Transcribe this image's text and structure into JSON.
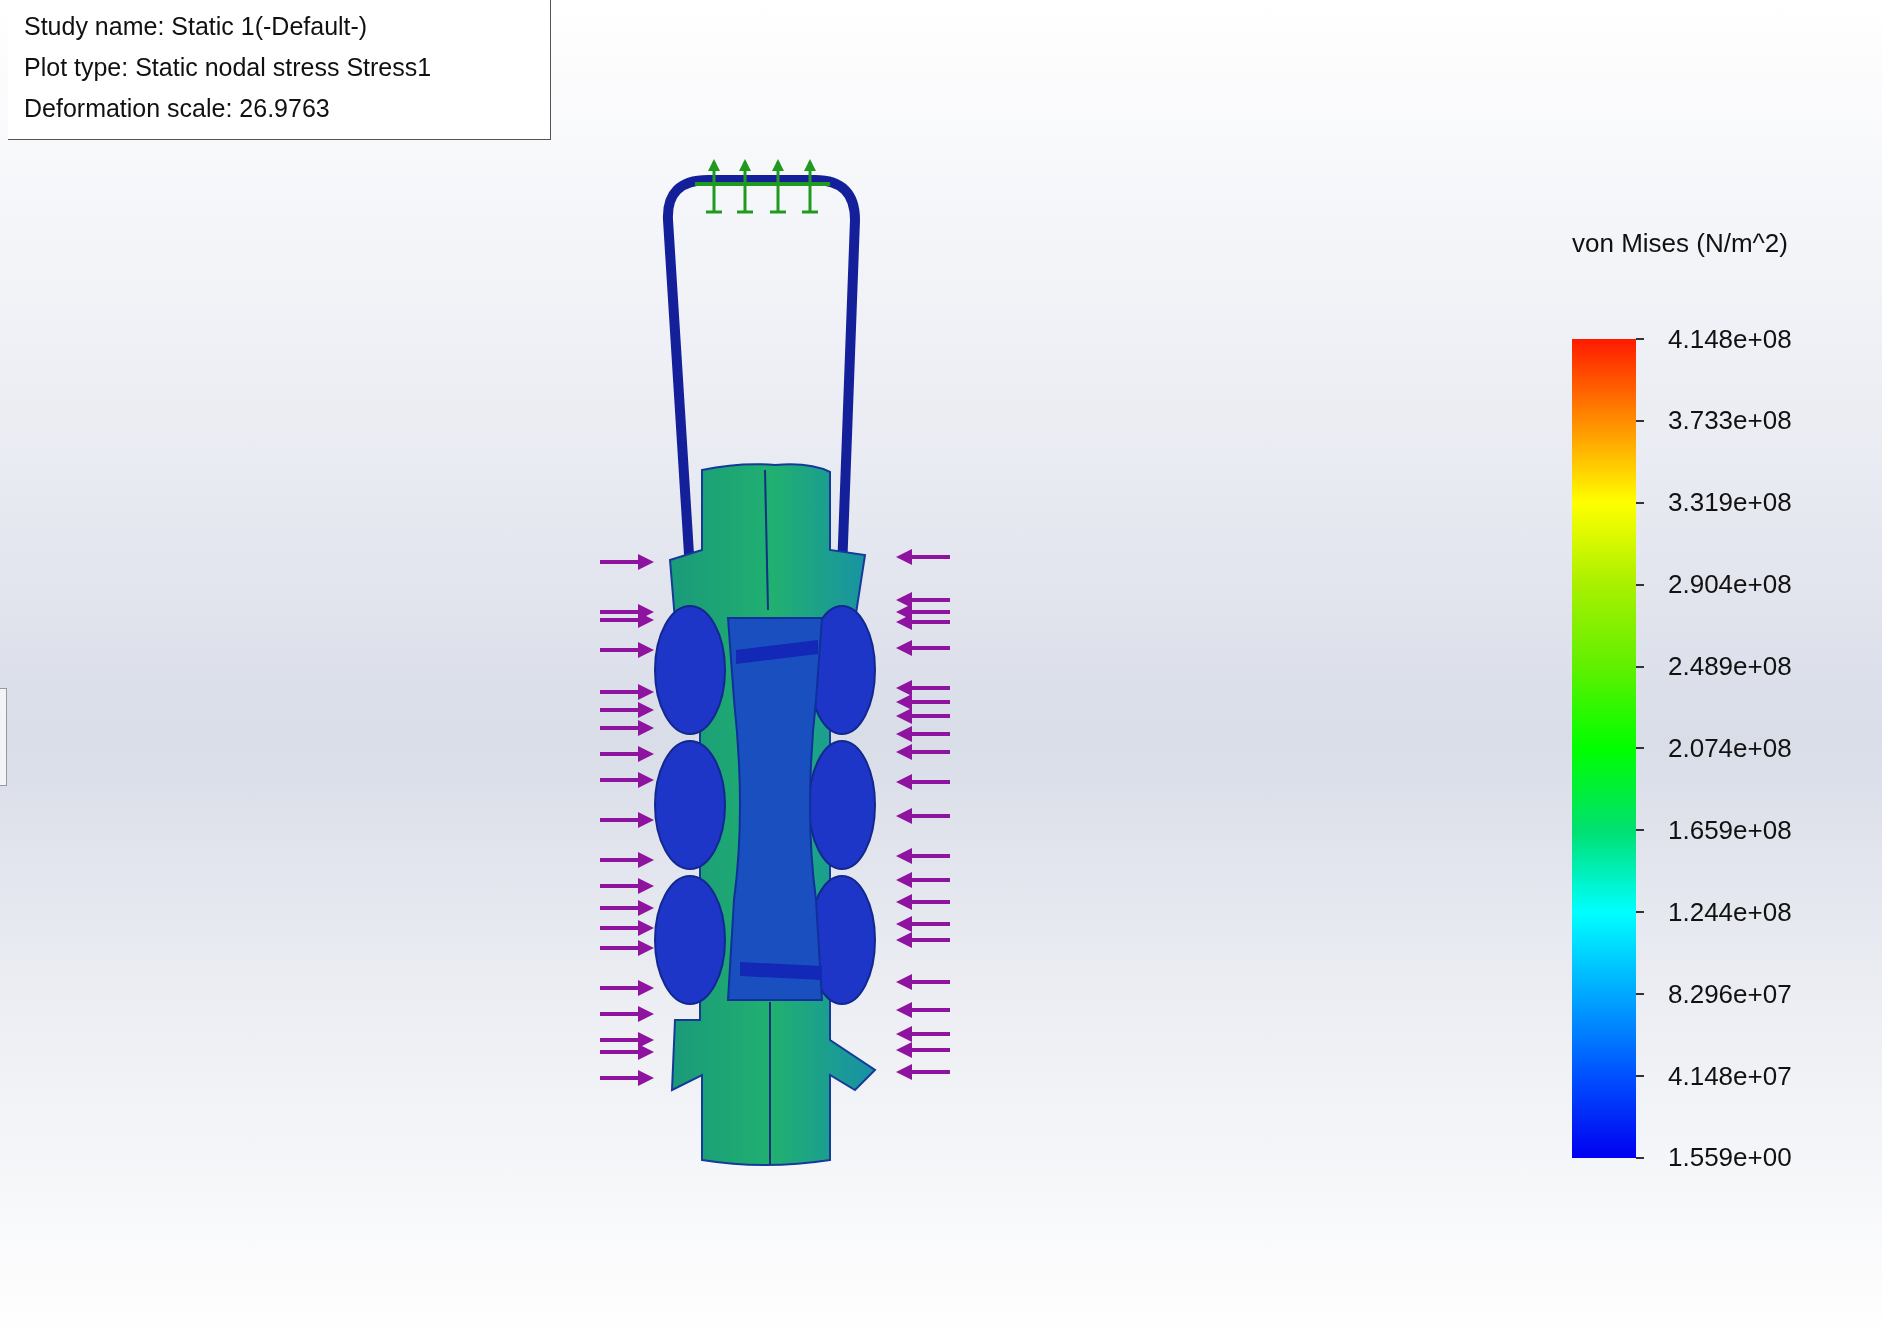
{
  "plot_info": {
    "lines": [
      "Study name: Static 1(-Default-)",
      "Plot type: Static nodal stress Stress1",
      "Deformation scale: 26.9763"
    ]
  },
  "legend": {
    "title": "von Mises (N/m^2)",
    "labels": [
      "4.148e+08",
      "3.733e+08",
      "3.319e+08",
      "2.904e+08",
      "2.489e+08",
      "2.074e+08",
      "1.659e+08",
      "1.244e+08",
      "8.296e+07",
      "4.148e+07",
      "1.559e+00"
    ]
  }
}
